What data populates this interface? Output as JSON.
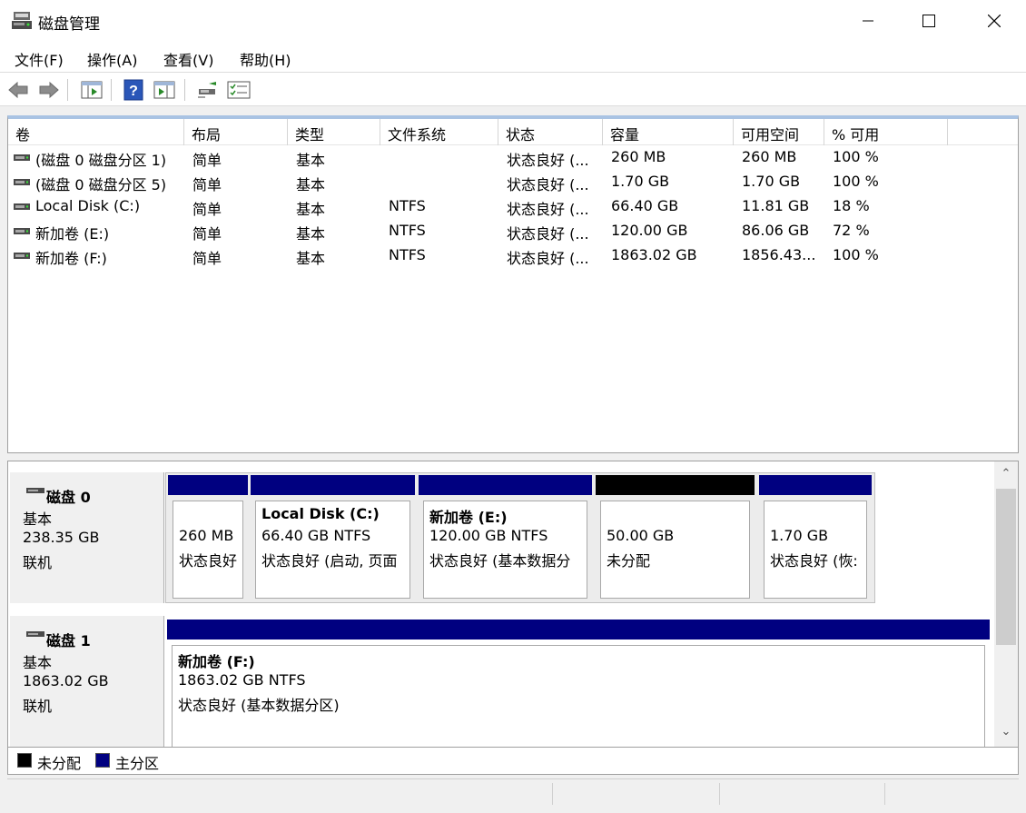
{
  "window": {
    "title": "磁盘管理"
  },
  "menu": [
    "文件(F)",
    "操作(A)",
    "查看(V)",
    "帮助(H)"
  ],
  "columns": [
    "卷",
    "布局",
    "类型",
    "文件系统",
    "状态",
    "容量",
    "可用空间",
    "% 可用"
  ],
  "volumes": [
    {
      "name": "(磁盘 0 磁盘分区 1)",
      "layout": "简单",
      "type": "基本",
      "fs": "",
      "status": "状态良好 (...",
      "capacity": "260 MB",
      "free": "260 MB",
      "pct": "100 %"
    },
    {
      "name": "(磁盘 0 磁盘分区 5)",
      "layout": "简单",
      "type": "基本",
      "fs": "",
      "status": "状态良好 (...",
      "capacity": "1.70 GB",
      "free": "1.70 GB",
      "pct": "100 %"
    },
    {
      "name": "Local Disk (C:)",
      "layout": "简单",
      "type": "基本",
      "fs": "NTFS",
      "status": "状态良好 (...",
      "capacity": "66.40 GB",
      "free": "11.81 GB",
      "pct": "18 %"
    },
    {
      "name": "新加卷 (E:)",
      "layout": "简单",
      "type": "基本",
      "fs": "NTFS",
      "status": "状态良好 (...",
      "capacity": "120.00 GB",
      "free": "86.06 GB",
      "pct": "72 %"
    },
    {
      "name": "新加卷 (F:)",
      "layout": "简单",
      "type": "基本",
      "fs": "NTFS",
      "status": "状态良好 (...",
      "capacity": "1863.02 GB",
      "free": "1856.43...",
      "pct": "100 %"
    }
  ],
  "disks": [
    {
      "name": "磁盘 0",
      "type": "基本",
      "size": "238.35 GB",
      "state": "联机",
      "partitions": [
        {
          "title": "",
          "line1": "260 MB",
          "line2": "状态良好",
          "kind": "primary"
        },
        {
          "title": "Local Disk  (C:)",
          "line1": "66.40 GB NTFS",
          "line2": "状态良好 (启动, 页面",
          "kind": "primary"
        },
        {
          "title": "新加卷  (E:)",
          "line1": "120.00 GB NTFS",
          "line2": "状态良好 (基本数据分",
          "kind": "primary"
        },
        {
          "title": "",
          "line1": "50.00 GB",
          "line2": "未分配",
          "kind": "unallocated"
        },
        {
          "title": "",
          "line1": "1.70 GB",
          "line2": "状态良好 (恢:",
          "kind": "primary"
        }
      ]
    },
    {
      "name": "磁盘 1",
      "type": "基本",
      "size": "1863.02 GB",
      "state": "联机",
      "partitions": [
        {
          "title": "新加卷  (F:)",
          "line1": "1863.02 GB NTFS",
          "line2": "状态良好 (基本数据分区)",
          "kind": "primary"
        }
      ]
    }
  ],
  "legend": [
    {
      "label": "未分配",
      "color": "#000000"
    },
    {
      "label": "主分区",
      "color": "#000080"
    }
  ],
  "colors": {
    "primary": "#000080",
    "unallocated": "#000000"
  }
}
